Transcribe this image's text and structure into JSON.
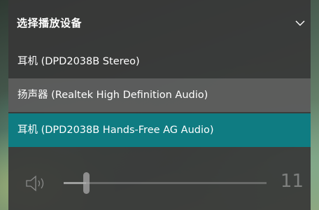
{
  "header": {
    "title": "选择播放设备",
    "collapse_icon": "chevron-down-icon"
  },
  "devices": [
    {
      "label": "耳机 (DPD2038B Stereo)",
      "state": "normal"
    },
    {
      "label": "扬声器 (Realtek High Definition Audio)",
      "state": "hover"
    },
    {
      "label": "耳机 (DPD2038B Hands-Free AG Audio)",
      "state": "selected"
    }
  ],
  "volume": {
    "icon": "speaker-icon",
    "value": "11",
    "level": 0.11
  },
  "colors": {
    "selected": "#0f7c82",
    "panel": "#383838"
  }
}
